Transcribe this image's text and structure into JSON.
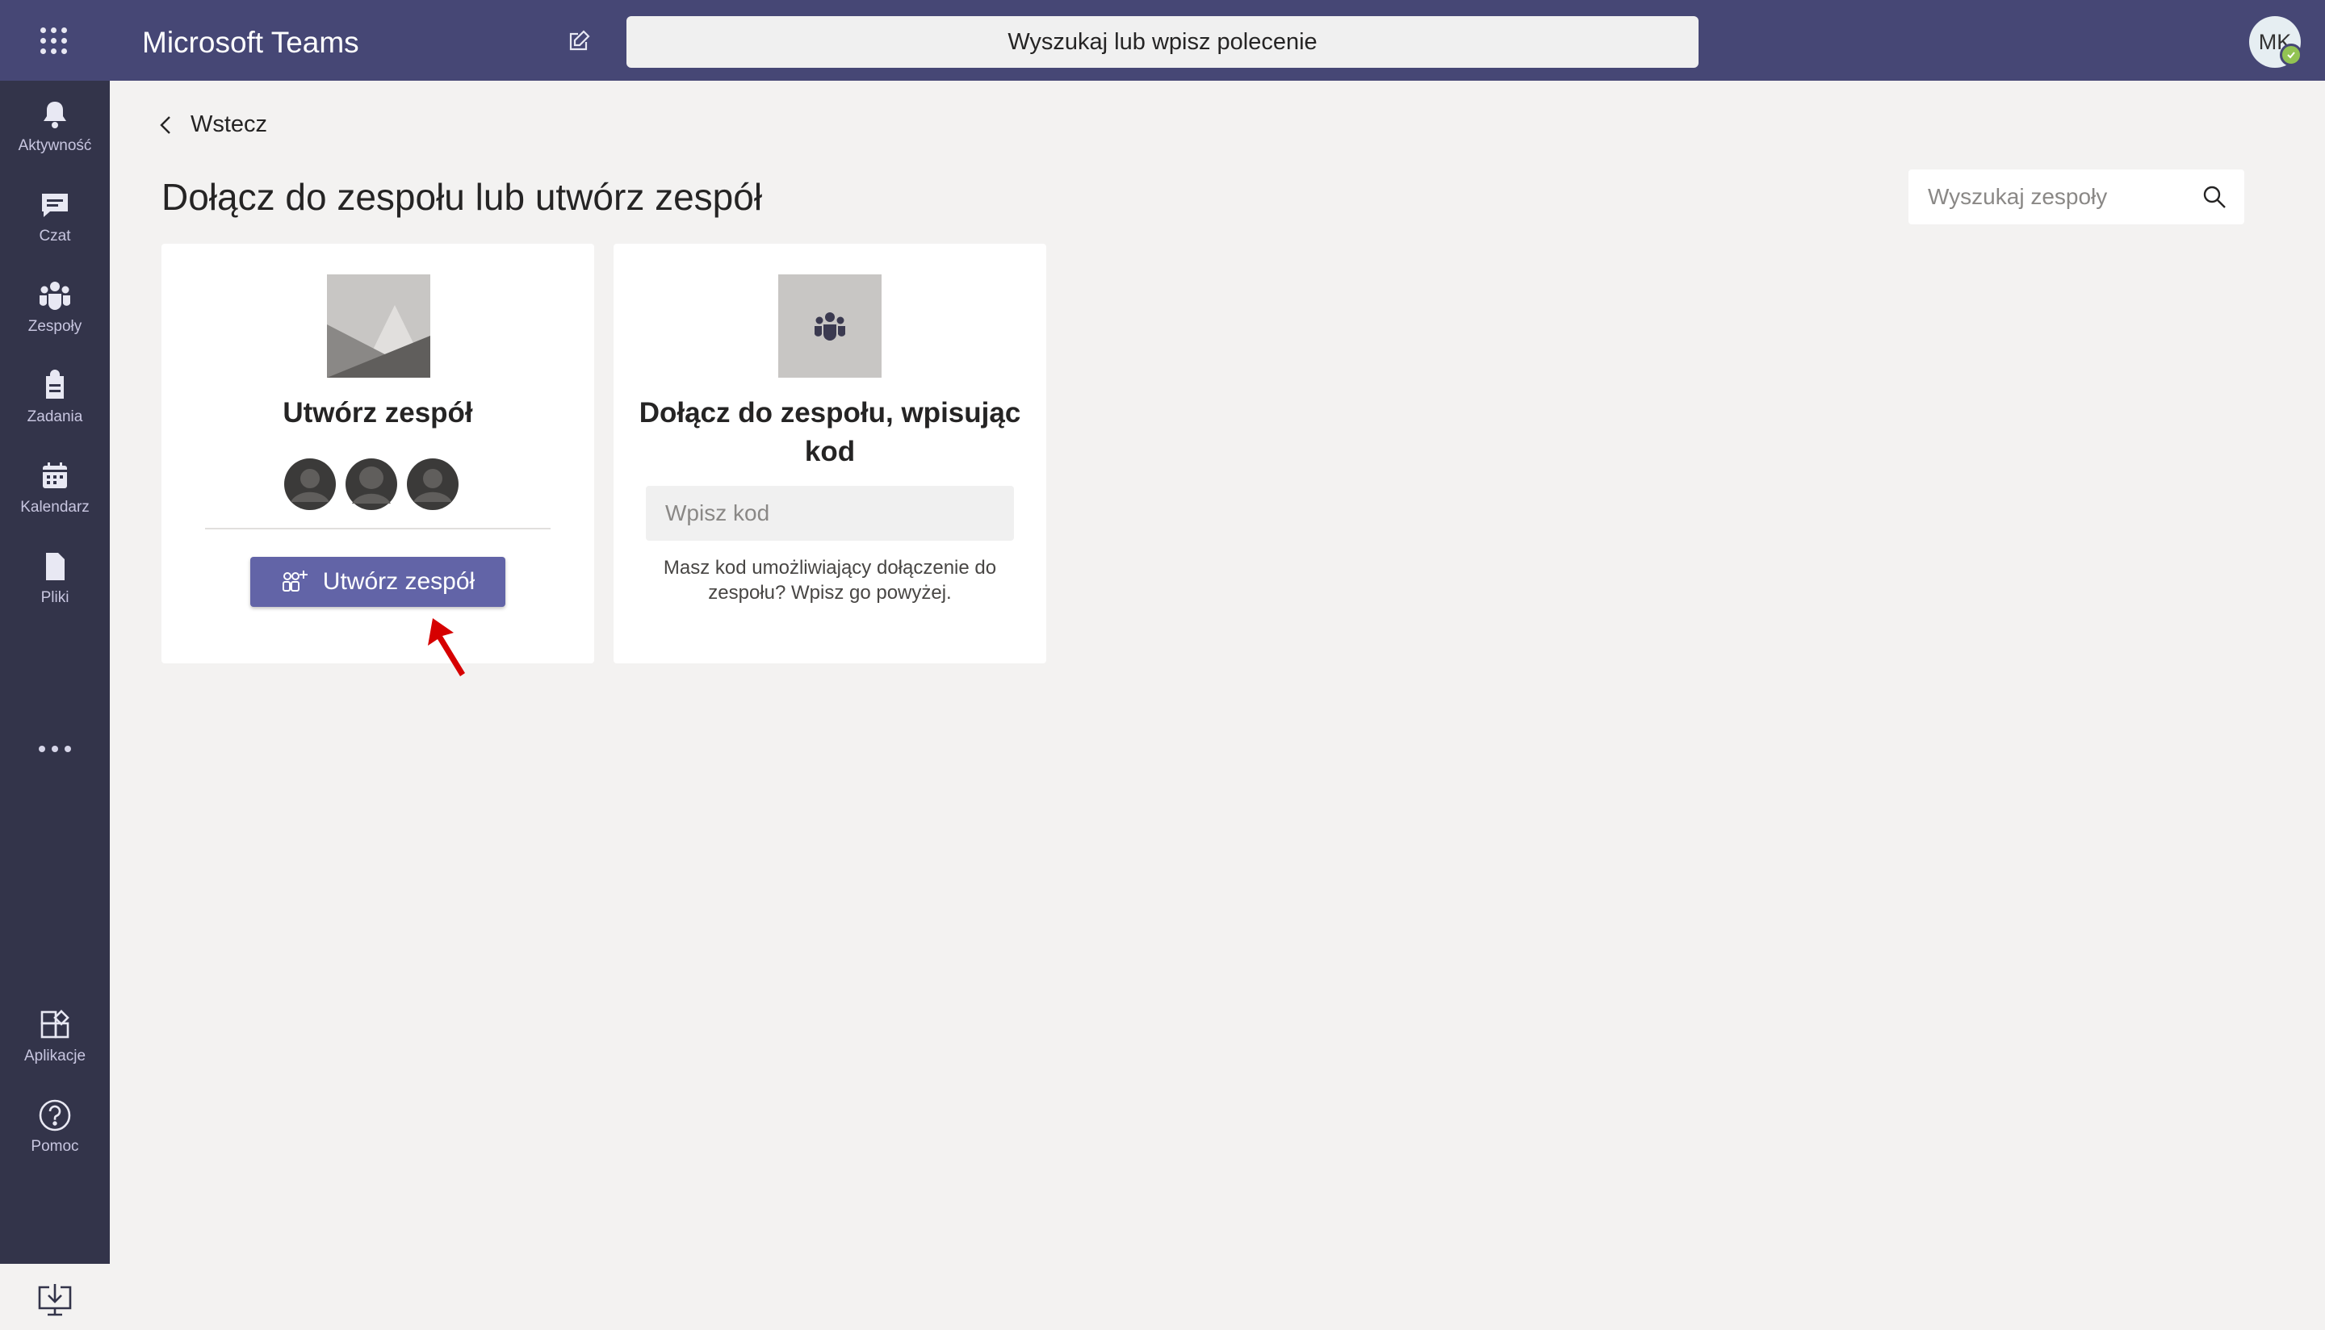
{
  "app": {
    "title": "Microsoft Teams"
  },
  "header": {
    "search_placeholder": "Wyszukaj lub wpisz polecenie",
    "avatar_initials": "MK"
  },
  "rail": {
    "items": [
      {
        "label": "Aktywność",
        "icon": "bell-icon"
      },
      {
        "label": "Czat",
        "icon": "chat-icon"
      },
      {
        "label": "Zespoły",
        "icon": "teams-icon"
      },
      {
        "label": "Zadania",
        "icon": "assignments-icon"
      },
      {
        "label": "Kalendarz",
        "icon": "calendar-icon"
      },
      {
        "label": "Pliki",
        "icon": "files-icon"
      }
    ],
    "bottom_items": [
      {
        "label": "Aplikacje",
        "icon": "apps-icon"
      },
      {
        "label": "Pomoc",
        "icon": "help-icon"
      }
    ]
  },
  "main": {
    "back_label": "Wstecz",
    "title": "Dołącz do zespołu lub utwórz zespół",
    "team_search_placeholder": "Wyszukaj zespoły",
    "create_card": {
      "title": "Utwórz zespół",
      "button_label": "Utwórz zespół"
    },
    "join_card": {
      "title": "Dołącz do zespołu, wpisując kod",
      "code_placeholder": "Wpisz kod",
      "help_text": "Masz kod umożliwiający dołączenie do zespołu? Wpisz go powyżej."
    }
  },
  "colors": {
    "header_bg": "#464775",
    "rail_bg": "#33344a",
    "accent": "#6264a7",
    "annotation_arrow": "#d60000"
  }
}
